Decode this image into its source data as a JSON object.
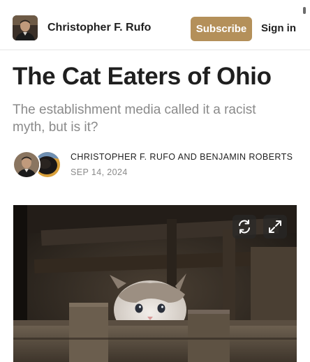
{
  "header": {
    "publication_name": "Christopher F. Rufo",
    "subscribe_label": "Subscribe",
    "signin_label": "Sign in"
  },
  "article": {
    "title": "The Cat Eaters of Ohio",
    "subtitle": "The establishment media called it a racist myth, but is it?",
    "authors": "CHRISTOPHER F. RUFO AND BENJAMIN ROBERTS",
    "date": "SEP 14, 2024"
  },
  "hero": {
    "controls": [
      "refresh-icon",
      "expand-icon"
    ]
  },
  "colors": {
    "accent": "#b4905a",
    "text": "#1f1f1f",
    "muted": "#8a8a8a"
  }
}
